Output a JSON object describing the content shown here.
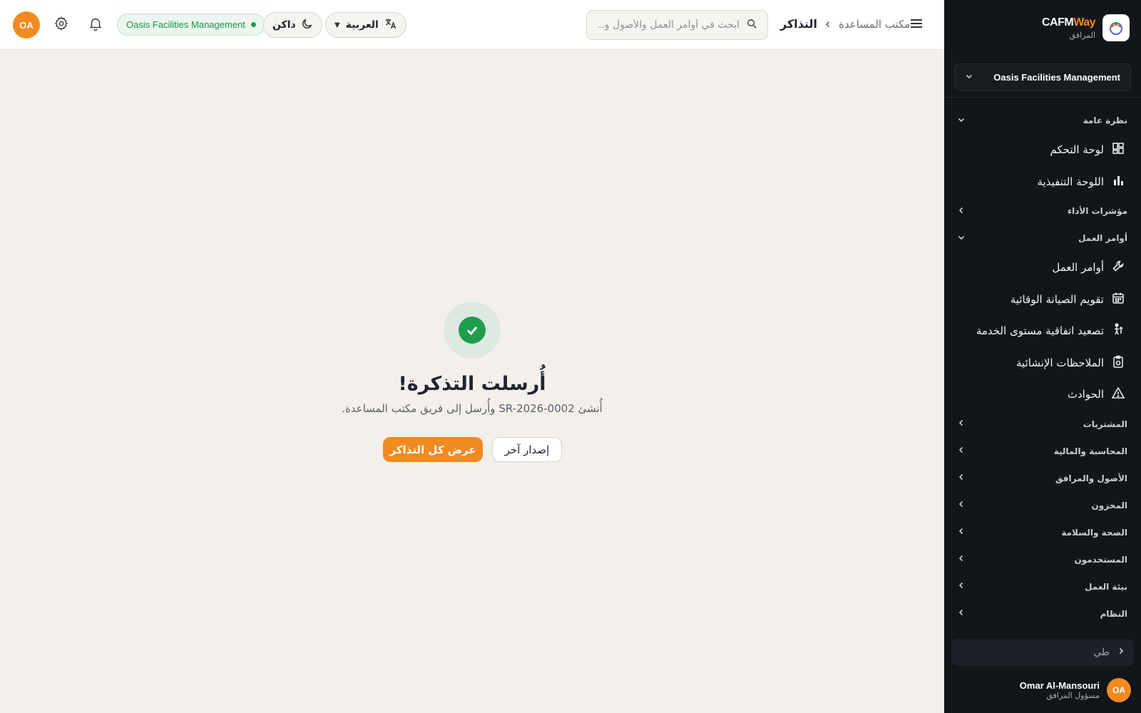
{
  "brand": {
    "name_main": "CAFM",
    "name_accent": "Way",
    "subtitle": "المرافق"
  },
  "organization": {
    "selector_label": "Oasis Facilities Management",
    "badge_label": "Oasis Facilities Management"
  },
  "sidebar": {
    "sections": [
      {
        "label": "نظرة عامة",
        "expanded": true
      },
      {
        "label": "مؤشرات الأداء",
        "expanded": false
      },
      {
        "label": "أوامر العمل",
        "expanded": true
      },
      {
        "label": "المشتريات",
        "expanded": false
      },
      {
        "label": "المحاسبة والمالية",
        "expanded": false
      },
      {
        "label": "الأصول والمرافق",
        "expanded": false
      },
      {
        "label": "المخزون",
        "expanded": false
      },
      {
        "label": "الصحة والسلامة",
        "expanded": false
      },
      {
        "label": "المستخدمون",
        "expanded": false
      },
      {
        "label": "بيئة العمل",
        "expanded": false
      },
      {
        "label": "النظام",
        "expanded": false
      }
    ],
    "overview_items": [
      {
        "label": "لوحة التحكم",
        "icon": "dashboard-icon"
      },
      {
        "label": "اللوحة التنفيذية",
        "icon": "bar-chart-icon"
      }
    ],
    "workorder_items": [
      {
        "label": "أوامر العمل",
        "icon": "wrench-icon"
      },
      {
        "label": "تقويم الصيانة الوقائية",
        "icon": "calendar-icon"
      },
      {
        "label": "تصعيد اتفاقية مستوى الخدمة",
        "icon": "escalation-icon"
      },
      {
        "label": "الملاحظات الإنشائية",
        "icon": "clipboard-icon"
      },
      {
        "label": "الحوادث",
        "icon": "warning-icon"
      }
    ],
    "collapse_label": "طي"
  },
  "user": {
    "initials": "OA",
    "name": "Omar Al-Mansouri",
    "role": "مسؤول المرافق"
  },
  "topbar": {
    "breadcrumb": {
      "parent": "مكتب المساعدة",
      "current": "التذاكر"
    },
    "search_placeholder": "ابحث في أوامر العمل والأصول و...",
    "language": "العربية",
    "theme": "داكن",
    "avatar_initials": "OA"
  },
  "main": {
    "title": "أُرسلت التذكرة!",
    "message": "أُنشئ SR-2026-0002 وأُرسل إلى فريق مكتب المساعدة.",
    "primary_button": "عرض كل التذاكر",
    "secondary_button": "إصدار آخر"
  },
  "colors": {
    "accent": "#f28a22",
    "success": "#1f9d4d",
    "sidebar_bg": "#121519",
    "page_bg": "#f3f0eb"
  }
}
